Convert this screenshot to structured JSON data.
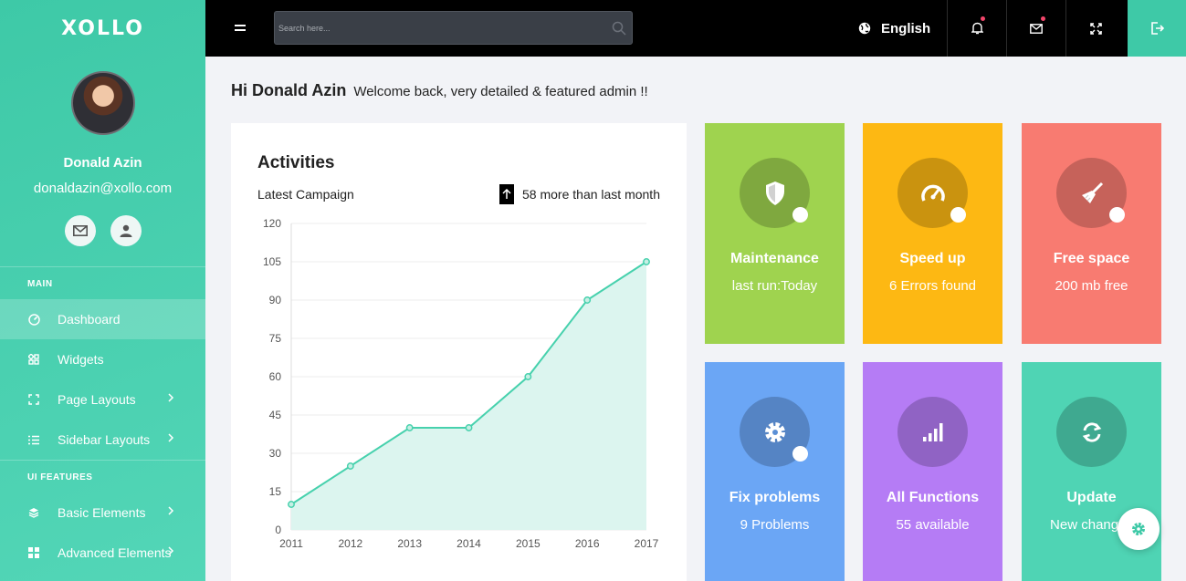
{
  "brand": {
    "logo": "XOLLO",
    "accent": "#3ec9a7"
  },
  "profile": {
    "name": "Donald Azin",
    "email": "donaldazin@xollo.com"
  },
  "sidebar": {
    "sections": [
      {
        "title": "MAIN",
        "items": [
          {
            "label": "Dashboard",
            "icon": "dashboard-icon",
            "active": true
          },
          {
            "label": "Widgets",
            "icon": "widgets-icon"
          },
          {
            "label": "Page Layouts",
            "icon": "page-layouts-icon",
            "has_submenu": true
          },
          {
            "label": "Sidebar Layouts",
            "icon": "sidebar-layouts-icon",
            "has_submenu": true
          }
        ]
      },
      {
        "title": "UI FEATURES",
        "items": [
          {
            "label": "Basic Elements",
            "icon": "layers-icon",
            "has_submenu": true
          },
          {
            "label": "Advanced Elements",
            "icon": "grid-icon",
            "has_submenu": true
          }
        ]
      }
    ]
  },
  "topbar": {
    "search_placeholder": "Search here...",
    "language": "English"
  },
  "greeting": {
    "hi": "Hi Donald Azin",
    "welcome": "Welcome back, very detailed & featured admin !!"
  },
  "activities": {
    "title": "Activities",
    "subtitle": "Latest Campaign",
    "trend": "58 more than last month"
  },
  "chart_data": {
    "type": "area",
    "x": [
      "2011",
      "2012",
      "2013",
      "2014",
      "2015",
      "2016",
      "2017"
    ],
    "values": [
      10,
      25,
      40,
      40,
      60,
      90,
      105
    ],
    "ylim": [
      0,
      120
    ],
    "yticks": [
      0,
      15,
      30,
      45,
      60,
      75,
      90,
      105,
      120
    ],
    "grid": true,
    "line_color": "#47d1ad",
    "fill_color": "#dcf5ef"
  },
  "cards": [
    {
      "title": "Maintenance",
      "subtitle": "last run:Today",
      "color": "#9fd34f",
      "icon": "shield-icon",
      "alert": true
    },
    {
      "title": "Speed up",
      "subtitle": "6 Errors found",
      "color": "#fdb813",
      "icon": "speedometer-icon",
      "alert": true
    },
    {
      "title": "Free space",
      "subtitle": "200 mb free",
      "color": "#f87b71",
      "icon": "broom-icon",
      "alert": true
    },
    {
      "title": "Fix problems",
      "subtitle": "9 Problems",
      "color": "#6ba6f5",
      "icon": "gear-icon",
      "alert": true
    },
    {
      "title": "All Functions",
      "subtitle": "55 available",
      "color": "#b57cf5",
      "icon": "signal-bars-icon",
      "alert": false
    },
    {
      "title": "Update",
      "subtitle": "New changes",
      "color": "#4fd4b4",
      "icon": "refresh-icon",
      "alert": false
    }
  ]
}
